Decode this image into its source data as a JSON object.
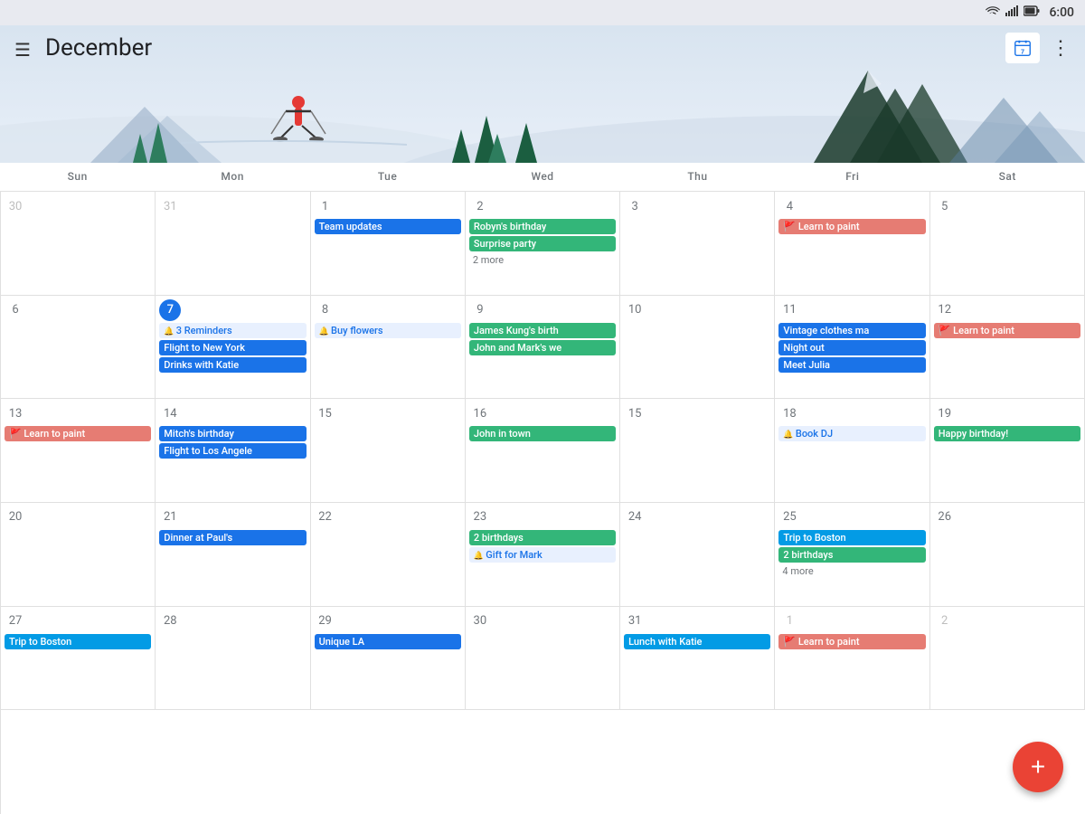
{
  "statusBar": {
    "time": "6:00",
    "icons": [
      "wifi",
      "signal",
      "battery"
    ]
  },
  "header": {
    "menuLabel": "☰",
    "monthTitle": "December",
    "todayDay": "7",
    "moreLabel": "⋮"
  },
  "dayHeaders": [
    "Sun",
    "Mon",
    "Tue",
    "Wed",
    "Thu",
    "Fri",
    "Sat"
  ],
  "weeks": [
    {
      "days": [
        {
          "num": "30",
          "otherMonth": true,
          "events": []
        },
        {
          "num": "31",
          "otherMonth": true,
          "events": []
        },
        {
          "num": "1",
          "events": [
            {
              "label": "Team updates",
              "color": "blue"
            }
          ]
        },
        {
          "num": "2",
          "events": [
            {
              "label": "Robyn's birthday",
              "color": "green"
            },
            {
              "label": "Surprise party",
              "color": "green"
            },
            {
              "label": "2 more",
              "isMore": true
            }
          ]
        },
        {
          "num": "3",
          "events": []
        },
        {
          "num": "4",
          "events": [
            {
              "label": "Learn to paint",
              "color": "orange",
              "hasFlag": true
            }
          ]
        },
        {
          "num": "5",
          "events": []
        }
      ]
    },
    {
      "days": [
        {
          "num": "6",
          "events": []
        },
        {
          "num": "7",
          "today": true,
          "events": [
            {
              "label": "3 Reminders",
              "color": "reminder"
            },
            {
              "label": "Flight to New York",
              "color": "blue"
            },
            {
              "label": "Drinks with Katie",
              "color": "blue"
            }
          ]
        },
        {
          "num": "8",
          "events": [
            {
              "label": "Buy flowers",
              "color": "reminder"
            }
          ]
        },
        {
          "num": "9",
          "events": [
            {
              "label": "James Kung's birth",
              "color": "green"
            },
            {
              "label": "John and Mark's we",
              "color": "green"
            }
          ]
        },
        {
          "num": "10",
          "events": []
        },
        {
          "num": "11",
          "events": [
            {
              "label": "Vintage clothes ma",
              "color": "blue"
            },
            {
              "label": "Night out",
              "color": "blue"
            },
            {
              "label": "Meet Julia",
              "color": "blue"
            }
          ]
        },
        {
          "num": "12",
          "events": [
            {
              "label": "Learn to paint",
              "color": "orange",
              "hasFlag": true
            }
          ]
        }
      ]
    },
    {
      "days": [
        {
          "num": "13",
          "events": [
            {
              "label": "Learn to paint",
              "color": "orange",
              "hasFlag": true
            }
          ]
        },
        {
          "num": "14",
          "events": [
            {
              "label": "Mitch's birthday",
              "color": "blue"
            },
            {
              "label": "Flight to Los Angele",
              "color": "blue"
            }
          ]
        },
        {
          "num": "15",
          "events": []
        },
        {
          "num": "16",
          "events": [
            {
              "label": "John in town",
              "color": "green"
            }
          ]
        },
        {
          "num": "15",
          "events": []
        },
        {
          "num": "18",
          "events": [
            {
              "label": "Book DJ",
              "color": "reminder"
            }
          ]
        },
        {
          "num": "19",
          "events": [
            {
              "label": "Happy birthday!",
              "color": "green"
            }
          ]
        }
      ]
    },
    {
      "days": [
        {
          "num": "20",
          "events": []
        },
        {
          "num": "21",
          "events": [
            {
              "label": "Dinner at Paul's",
              "color": "blue"
            }
          ]
        },
        {
          "num": "22",
          "events": []
        },
        {
          "num": "23",
          "events": [
            {
              "label": "2 birthdays",
              "color": "green"
            },
            {
              "label": "Gift for Mark",
              "color": "reminder"
            }
          ]
        },
        {
          "num": "24",
          "events": []
        },
        {
          "num": "25",
          "events": [
            {
              "label": "Trip to Boston",
              "color": "cyan",
              "wide": true
            },
            {
              "label": "2 birthdays",
              "color": "green"
            },
            {
              "label": "4 more",
              "isMore": true
            }
          ]
        },
        {
          "num": "26",
          "events": []
        }
      ]
    },
    {
      "days": [
        {
          "num": "27",
          "events": [
            {
              "label": "Trip to Boston",
              "color": "cyan"
            }
          ]
        },
        {
          "num": "28",
          "events": []
        },
        {
          "num": "29",
          "events": [
            {
              "label": "Unique LA",
              "color": "blue"
            }
          ]
        },
        {
          "num": "30",
          "events": []
        },
        {
          "num": "31",
          "events": [
            {
              "label": "Lunch with Katie",
              "color": "cyan"
            }
          ]
        },
        {
          "num": "1",
          "otherMonth": true,
          "events": [
            {
              "label": "Learn to paint",
              "color": "orange",
              "hasFlag": true
            }
          ]
        },
        {
          "num": "2",
          "otherMonth": true,
          "events": []
        }
      ]
    }
  ],
  "fab": {
    "label": "+"
  }
}
